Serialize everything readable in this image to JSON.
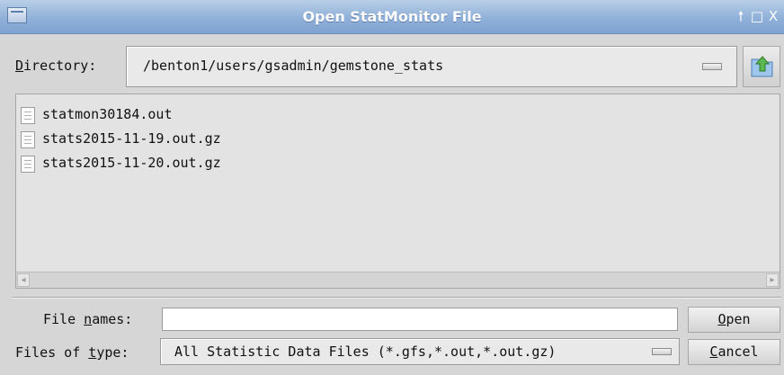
{
  "window": {
    "title": "Open StatMonitor File",
    "controls": {
      "shade": "🠕",
      "maximize": "□",
      "close": "X"
    }
  },
  "directory": {
    "label_mnemonic": "D",
    "label_rest": "irectory:",
    "path": "/benton1/users/gsadmin/gemstone_stats"
  },
  "files": [
    {
      "name": "statmon30184.out"
    },
    {
      "name": "stats2015-11-19.out.gz"
    },
    {
      "name": "stats2015-11-20.out.gz"
    }
  ],
  "file_names": {
    "label_pre": "File ",
    "label_mnemonic": "n",
    "label_post": "ames:",
    "value": ""
  },
  "file_type": {
    "label_pre": "Files of ",
    "label_mnemonic": "t",
    "label_post": "ype:",
    "selected": "All Statistic Data Files (*.gfs,*.out,*.out.gz)"
  },
  "buttons": {
    "open_mnemonic": "O",
    "open_rest": "pen",
    "cancel_mnemonic": "C",
    "cancel_rest": "ancel"
  },
  "icons": {
    "up_folder": "folder-up-icon",
    "file": "document-icon"
  },
  "colors": {
    "titlebar": "#8fb0d8",
    "background": "#d6d6d6",
    "up_arrow": "#4fa34a"
  }
}
